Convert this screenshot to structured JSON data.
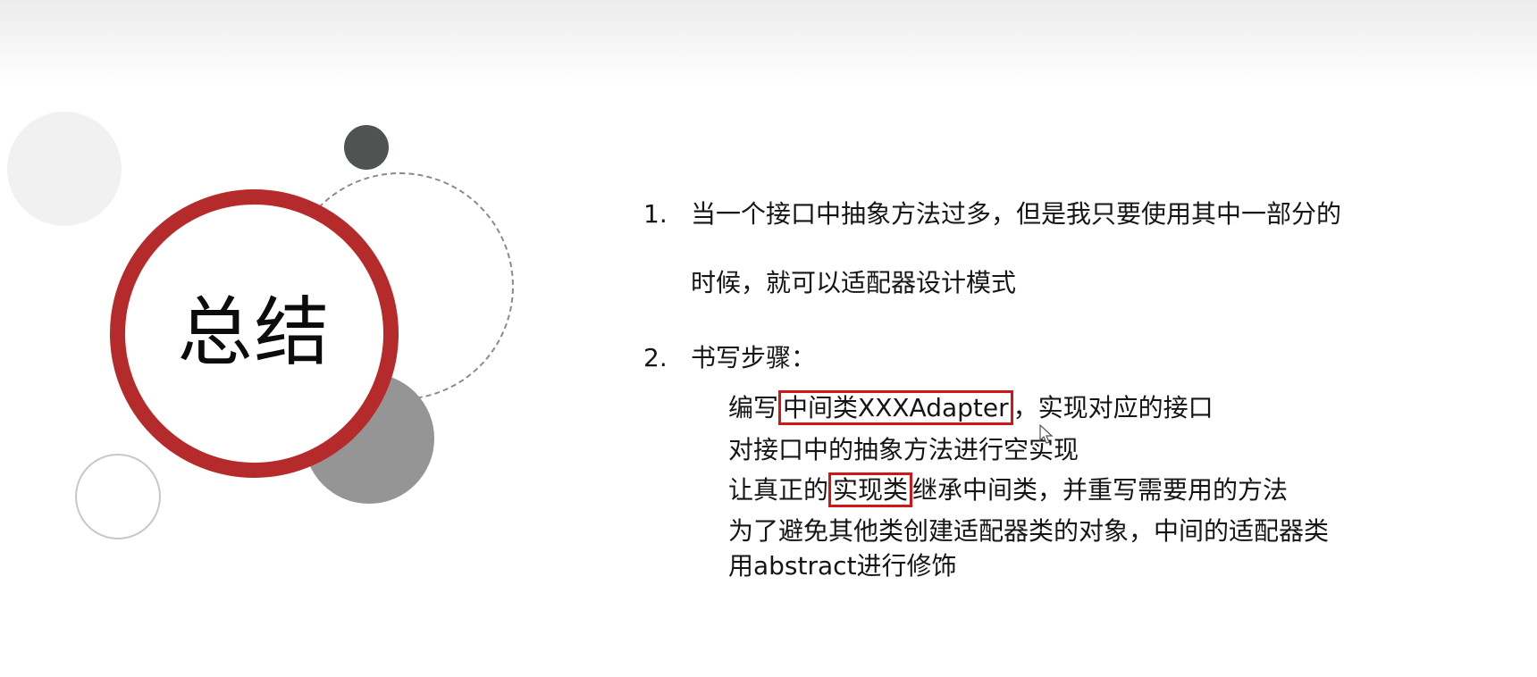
{
  "slide": {
    "title": "总结",
    "point1": {
      "number": "1.",
      "line1": "当一个接口中抽象方法过多，但是我只要使用其中一部分的",
      "line2": "时候，就可以适配器设计模式"
    },
    "point2": {
      "number": "2.",
      "heading": "书写步骤：",
      "steps": [
        {
          "before": "编写",
          "highlight": "中间类XXXAdapter",
          "after": "，实现对应的接口"
        },
        {
          "text": "对接口中的抽象方法进行空实现"
        },
        {
          "before": "让真正的",
          "highlight": "实现类",
          "after": "继承中间类，并重写需要用的方法"
        },
        {
          "text": "为了避免其他类创建适配器类的对象，中间的适配器类"
        },
        {
          "text": "用abstract进行修饰"
        }
      ]
    },
    "colors": {
      "accent_red": "#b52a2a",
      "highlight_border": "#d11616"
    }
  }
}
